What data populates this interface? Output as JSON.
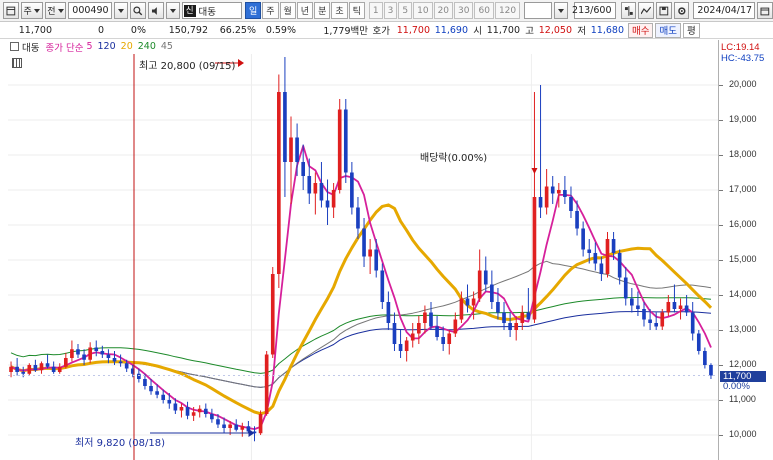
{
  "toolbar": {
    "type_label": "주",
    "sub_label": "전",
    "code": "000490",
    "market_badge": "신",
    "stock_name": "대동",
    "periods": [
      "일",
      "주",
      "월",
      "년",
      "분",
      "초",
      "틱"
    ],
    "active_period": "일",
    "period_numbers": [
      "1",
      "3",
      "5",
      "10",
      "20",
      "30",
      "60",
      "120"
    ],
    "count": "213",
    "count_max": "/600",
    "date": "2024/04/17"
  },
  "infobar": {
    "price": "11,700",
    "change": "0",
    "change_pct": "0%",
    "volume": "150,792",
    "volume_pct": "66.25%",
    "rate": "0.59%",
    "amount": "1,779백만",
    "quote_label": "호가",
    "quote_ask": "11,700",
    "quote_bid": "11,690",
    "open_label": "시",
    "open": "11,700",
    "high_label": "고",
    "high": "12,050",
    "low_label": "저",
    "low": "11,680",
    "buy_button": "매수",
    "sell_button": "매도",
    "eval_button": "평"
  },
  "legend": {
    "stock": "대동",
    "ma_label": "종가 단순",
    "ma_periods": [
      "5",
      "120",
      "20",
      "240",
      "45"
    ],
    "ma_colors": [
      "#d6209b",
      "#1a2f9e",
      "#e6a800",
      "#1d8a2a",
      "#777777"
    ]
  },
  "right_info": {
    "lc": "LC:19.14",
    "hc": "HC:-43.75",
    "current_price": "11,700",
    "current_pct": "0.00%"
  },
  "annotations": {
    "high": "최고 20,800 (09/15)",
    "low": "최저 9,820 (08/18)",
    "dividend": "배당락(0.00%)"
  },
  "chart_data": {
    "type": "candlestick",
    "yticks": [
      "20,000",
      "19,000",
      "18,000",
      "17,000",
      "16,000",
      "15,000",
      "14,000",
      "13,000",
      "12,000",
      "11,000",
      "10,000"
    ],
    "ylim": [
      9700,
      20700
    ],
    "candles": [
      [
        11800,
        12100,
        11650,
        11950
      ],
      [
        11950,
        12200,
        11700,
        11800
      ],
      [
        11800,
        11950,
        11650,
        11750
      ],
      [
        11750,
        12050,
        11700,
        12000
      ],
      [
        12000,
        12150,
        11800,
        11850
      ],
      [
        11850,
        12100,
        11750,
        12050
      ],
      [
        12050,
        12300,
        11900,
        11950
      ],
      [
        11950,
        12100,
        11750,
        11800
      ],
      [
        11800,
        12050,
        11750,
        11950
      ],
      [
        11950,
        12350,
        11900,
        12200
      ],
      [
        12200,
        12700,
        12100,
        12450
      ],
      [
        12450,
        12600,
        12200,
        12300
      ],
      [
        12300,
        12450,
        12000,
        12150
      ],
      [
        12150,
        12650,
        12050,
        12500
      ],
      [
        12500,
        12700,
        12250,
        12400
      ],
      [
        12400,
        12550,
        12200,
        12300
      ],
      [
        12300,
        12450,
        12050,
        12200
      ],
      [
        12200,
        12400,
        12000,
        12100
      ],
      [
        12100,
        12300,
        11950,
        12050
      ],
      [
        12050,
        12150,
        11800,
        11900
      ],
      [
        11900,
        12000,
        11650,
        11750
      ],
      [
        11750,
        11900,
        11500,
        11600
      ],
      [
        11600,
        11750,
        11300,
        11400
      ],
      [
        11400,
        11600,
        11150,
        11250
      ],
      [
        11250,
        11450,
        11050,
        11150
      ],
      [
        11150,
        11300,
        10900,
        11000
      ],
      [
        11000,
        11200,
        10750,
        10900
      ],
      [
        10900,
        11050,
        10600,
        10700
      ],
      [
        10700,
        10900,
        10500,
        10800
      ],
      [
        10800,
        10950,
        10450,
        10550
      ],
      [
        10550,
        10800,
        10400,
        10650
      ],
      [
        10650,
        10850,
        10500,
        10750
      ],
      [
        10750,
        10900,
        10500,
        10600
      ],
      [
        10600,
        10750,
        10350,
        10450
      ],
      [
        10450,
        10600,
        10200,
        10300
      ],
      [
        10300,
        10500,
        10050,
        10200
      ],
      [
        10200,
        10400,
        10000,
        10300
      ],
      [
        10300,
        10450,
        10100,
        10150
      ],
      [
        10150,
        10350,
        9950,
        10250
      ],
      [
        10250,
        10400,
        10050,
        10100
      ],
      [
        10100,
        10250,
        9820,
        10050
      ],
      [
        10050,
        10700,
        10000,
        10600
      ],
      [
        10600,
        12400,
        10550,
        12300
      ],
      [
        12300,
        14800,
        12200,
        14600
      ],
      [
        14600,
        20300,
        14200,
        19800
      ],
      [
        19800,
        20800,
        16800,
        17800
      ],
      [
        17800,
        19100,
        16600,
        18500
      ],
      [
        18500,
        18900,
        17400,
        17800
      ],
      [
        17800,
        18300,
        17000,
        17400
      ],
      [
        17400,
        17900,
        16600,
        16900
      ],
      [
        16900,
        17500,
        16300,
        17200
      ],
      [
        17200,
        17800,
        16500,
        16700
      ],
      [
        16700,
        17300,
        16000,
        16500
      ],
      [
        16500,
        17200,
        16200,
        17000
      ],
      [
        17000,
        19600,
        16900,
        19300
      ],
      [
        19300,
        19600,
        17200,
        17500
      ],
      [
        17500,
        17800,
        16300,
        16500
      ],
      [
        16500,
        16800,
        15600,
        15900
      ],
      [
        15900,
        16200,
        14800,
        15100
      ],
      [
        15100,
        15600,
        14600,
        15300
      ],
      [
        15300,
        15600,
        14500,
        14700
      ],
      [
        14700,
        14900,
        13600,
        13800
      ],
      [
        13800,
        14100,
        13000,
        13200
      ],
      [
        13200,
        13500,
        12400,
        12600
      ],
      [
        12600,
        13000,
        12200,
        12400
      ],
      [
        12400,
        12800,
        12100,
        12700
      ],
      [
        12700,
        13200,
        12500,
        12900
      ],
      [
        12900,
        13400,
        12600,
        13200
      ],
      [
        13200,
        13700,
        12900,
        13500
      ],
      [
        13500,
        13800,
        13000,
        13100
      ],
      [
        13100,
        13400,
        12700,
        12800
      ],
      [
        12800,
        13100,
        12400,
        12600
      ],
      [
        12600,
        13000,
        12300,
        12900
      ],
      [
        12900,
        13500,
        12800,
        13300
      ],
      [
        13300,
        14100,
        13200,
        13900
      ],
      [
        13900,
        14300,
        13500,
        13700
      ],
      [
        13700,
        14100,
        13300,
        13900
      ],
      [
        13900,
        15300,
        13800,
        14700
      ],
      [
        14700,
        15100,
        14100,
        14300
      ],
      [
        14300,
        14700,
        13600,
        13800
      ],
      [
        13800,
        14200,
        13300,
        13500
      ],
      [
        13500,
        13800,
        13000,
        13200
      ],
      [
        13200,
        13500,
        12800,
        13000
      ],
      [
        13000,
        13400,
        12700,
        13200
      ],
      [
        13200,
        13700,
        13000,
        13500
      ],
      [
        13500,
        14200,
        13300,
        13300
      ],
      [
        13300,
        19800,
        13200,
        16800
      ],
      [
        16800,
        20000,
        16200,
        16500
      ],
      [
        16500,
        17600,
        16300,
        17100
      ],
      [
        17100,
        17400,
        16600,
        16900
      ],
      [
        16900,
        17200,
        16500,
        17000
      ],
      [
        17000,
        17400,
        16600,
        16800
      ],
      [
        16800,
        17100,
        16200,
        16400
      ],
      [
        16400,
        16700,
        15700,
        15900
      ],
      [
        15900,
        16100,
        15100,
        15300
      ],
      [
        15300,
        15600,
        14900,
        15200
      ],
      [
        15200,
        15500,
        14700,
        14900
      ],
      [
        14900,
        15100,
        14400,
        14600
      ],
      [
        14600,
        15800,
        14500,
        15600
      ],
      [
        15600,
        15800,
        15000,
        15200
      ],
      [
        15200,
        15300,
        14300,
        14500
      ],
      [
        14500,
        14800,
        13700,
        13900
      ],
      [
        13900,
        14200,
        13500,
        13700
      ],
      [
        13700,
        14100,
        13400,
        13600
      ],
      [
        13600,
        13800,
        13100,
        13300
      ],
      [
        13300,
        13600,
        13000,
        13200
      ],
      [
        13200,
        13500,
        13000,
        13100
      ],
      [
        13100,
        13600,
        13000,
        13500
      ],
      [
        13500,
        14000,
        13400,
        13800
      ],
      [
        13800,
        14300,
        13500,
        13600
      ],
      [
        13600,
        13900,
        13300,
        13700
      ],
      [
        13700,
        14000,
        13400,
        13500
      ],
      [
        13500,
        13800,
        12700,
        12900
      ],
      [
        12900,
        13000,
        12300,
        12400
      ],
      [
        12400,
        12500,
        11900,
        12000
      ],
      [
        12000,
        12050,
        11600,
        11700
      ]
    ],
    "high_marker": {
      "index": 45,
      "price": 20800
    },
    "low_marker": {
      "index": 40,
      "price": 9820
    },
    "dividend_index": 86,
    "current": 11700
  }
}
